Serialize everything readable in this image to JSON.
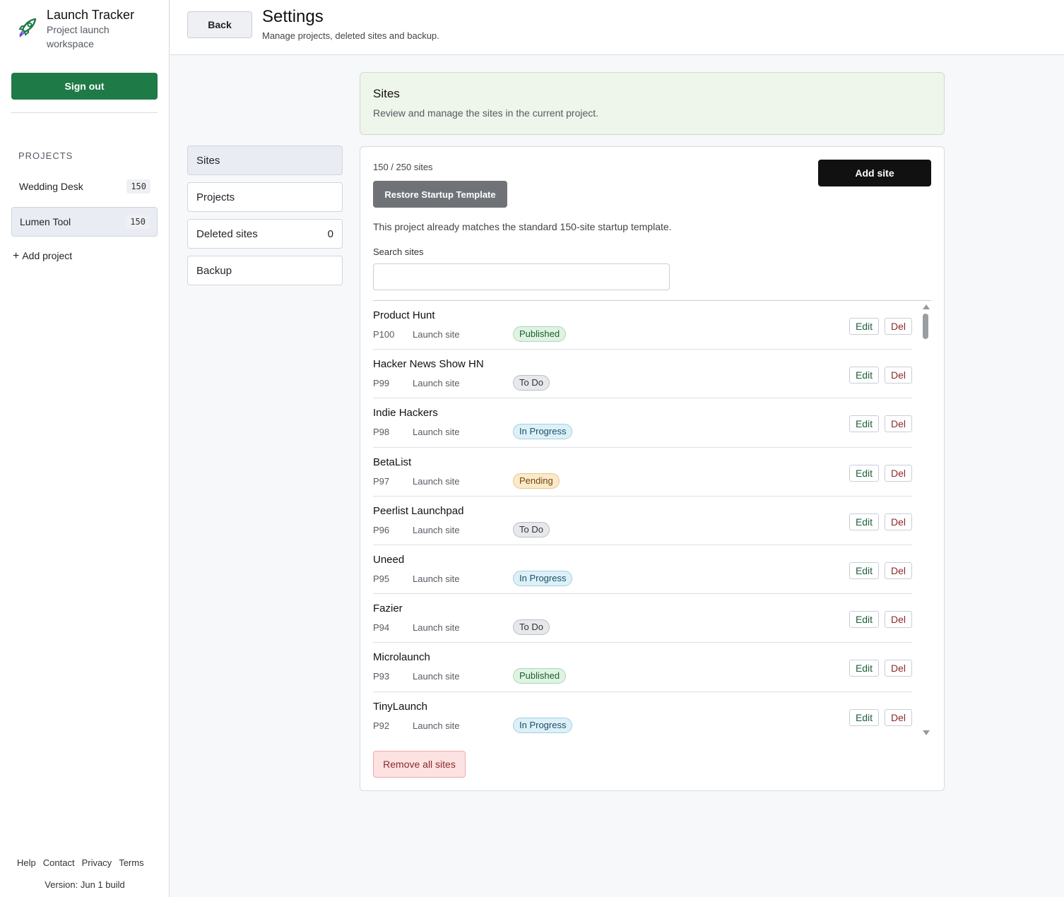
{
  "app": {
    "title": "Launch Tracker",
    "subtitle": "Project launch workspace",
    "icon": "rocket-icon",
    "sign_out_label": "Sign out"
  },
  "sidebar": {
    "section_label": "PROJECTS",
    "projects": [
      {
        "name": "Wedding Desk",
        "count": "150",
        "active": false
      },
      {
        "name": "Lumen Tool",
        "count": "150",
        "active": true
      }
    ],
    "add_project_label": "Add project",
    "footer_links": [
      "Help",
      "Contact",
      "Privacy",
      "Terms"
    ],
    "version": "Version: Jun 1 build"
  },
  "header": {
    "back_label": "Back",
    "title": "Settings",
    "subtitle": "Manage projects, deleted sites and backup."
  },
  "settings_menu": [
    {
      "label": "Sites",
      "count": "",
      "active": true
    },
    {
      "label": "Projects",
      "count": "",
      "active": false
    },
    {
      "label": "Deleted sites",
      "count": "0",
      "active": false
    },
    {
      "label": "Backup",
      "count": "",
      "active": false
    }
  ],
  "banner": {
    "title": "Sites",
    "subtitle": "Review and manage the sites in the current project."
  },
  "sites_panel": {
    "count_text": "150 / 250 sites",
    "add_site_label": "Add site",
    "restore_label": "Restore Startup Template",
    "template_note": "This project already matches the standard 150-site startup template.",
    "search_label": "Search sites",
    "search_value": "",
    "edit_label": "Edit",
    "del_label": "Del",
    "remove_all_label": "Remove all sites",
    "scroll_position": 0.0,
    "rows": [
      {
        "name": "Product Hunt",
        "id": "P100",
        "type": "Launch site",
        "status": "Published",
        "status_key": "published"
      },
      {
        "name": "Hacker News Show HN",
        "id": "P99",
        "type": "Launch site",
        "status": "To Do",
        "status_key": "todo"
      },
      {
        "name": "Indie Hackers",
        "id": "P98",
        "type": "Launch site",
        "status": "In Progress",
        "status_key": "inprogress"
      },
      {
        "name": "BetaList",
        "id": "P97",
        "type": "Launch site",
        "status": "Pending",
        "status_key": "pending"
      },
      {
        "name": "Peerlist Launchpad",
        "id": "P96",
        "type": "Launch site",
        "status": "To Do",
        "status_key": "todo"
      },
      {
        "name": "Uneed",
        "id": "P95",
        "type": "Launch site",
        "status": "In Progress",
        "status_key": "inprogress"
      },
      {
        "name": "Fazier",
        "id": "P94",
        "type": "Launch site",
        "status": "To Do",
        "status_key": "todo"
      },
      {
        "name": "Microlaunch",
        "id": "P93",
        "type": "Launch site",
        "status": "Published",
        "status_key": "published"
      },
      {
        "name": "TinyLaunch",
        "id": "P92",
        "type": "Launch site",
        "status": "In Progress",
        "status_key": "inprogress"
      }
    ]
  },
  "colors": {
    "primary_green": "#1e7a46",
    "black_button": "#111111",
    "restore_gray": "#6f7378",
    "danger_bg": "#fde2e2"
  }
}
